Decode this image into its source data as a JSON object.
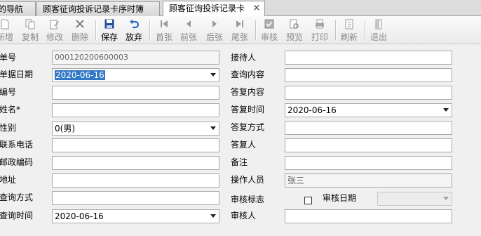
{
  "tabs": [
    {
      "label": "我的导航"
    },
    {
      "label": "顾客征询投诉记录卡序时簿"
    },
    {
      "label": "顾客征询投诉记录卡",
      "close": "×"
    }
  ],
  "toolbar": {
    "new": "新增",
    "copy": "复制",
    "edit": "修改",
    "delete": "删除",
    "save": "保存",
    "discard": "放弃",
    "first": "首张",
    "prev": "前张",
    "next": "后张",
    "last": "尾张",
    "audit": "审核",
    "preview": "预览",
    "print": "打印",
    "refresh": "刷新",
    "exit": "退出"
  },
  "form": {
    "left": {
      "doc_no_label": "单号",
      "doc_no_value": "000120200600003",
      "doc_date_label": "单据日期",
      "doc_date_value": "2020-06-16",
      "code_label": "编号",
      "name_label": "姓名*",
      "gender_label": "性别",
      "gender_value": "0(男)",
      "phone_label": "联系电话",
      "postcode_label": "邮政编码",
      "address_label": "地址",
      "inquiry_method_label": "查询方式",
      "inquiry_time_label": "查询时间",
      "inquiry_time_value": "2020-06-16"
    },
    "right": {
      "receiver_label": "接待人",
      "inquiry_content_label": "查询内容",
      "reply_content_label": "答复内容",
      "reply_time_label": "答复时间",
      "reply_time_value": "2020-06-16",
      "reply_method_label": "答复方式",
      "replier_label": "答复人",
      "remark_label": "备注",
      "operator_label": "操作人员",
      "operator_value": "张三",
      "audit_flag_label": "审核标志",
      "audit_flag_checked": false,
      "audit_date_label": "审核日期",
      "auditor_label": "审核人"
    }
  },
  "colors": {
    "selection": "#3178c6",
    "save_icon": "#1f4e9c",
    "discard_icon": "#2a6fc2",
    "disabled_icon": "#9a9a9a"
  }
}
